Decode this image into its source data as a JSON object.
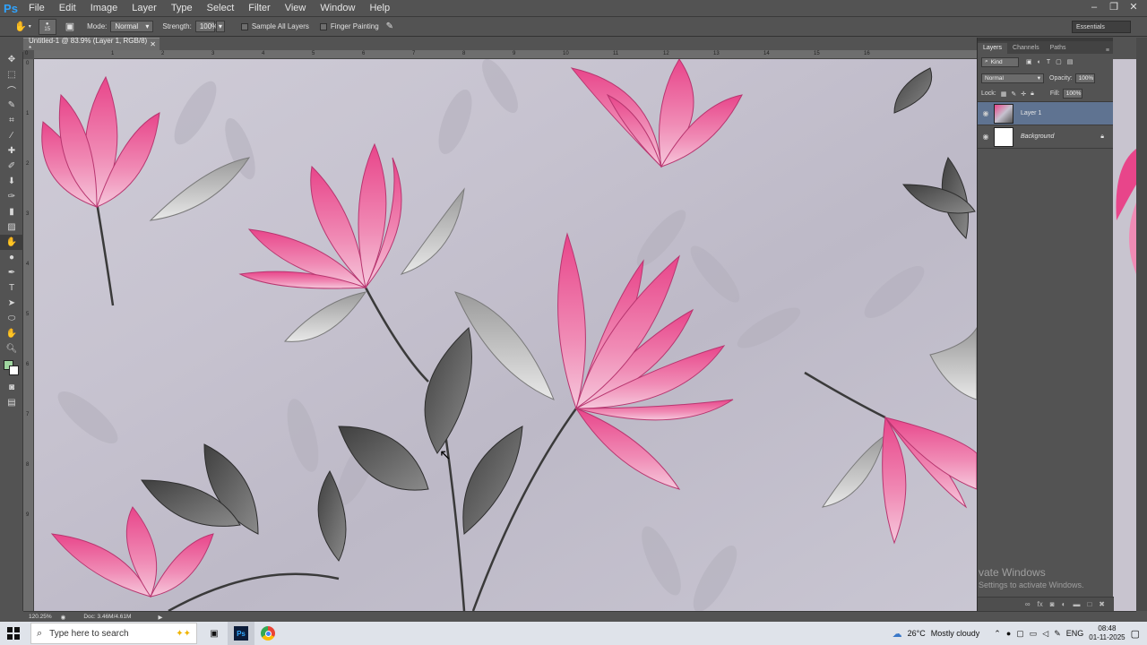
{
  "app": {
    "logo": "Ps"
  },
  "menu": [
    "File",
    "Edit",
    "Image",
    "Layer",
    "Type",
    "Select",
    "Filter",
    "View",
    "Window",
    "Help"
  ],
  "window_controls": [
    "minimize-icon",
    "restore-icon",
    "close-icon"
  ],
  "options_bar": {
    "brush_size": "15",
    "mode_label": "Mode:",
    "mode_value": "Normal",
    "strength_label": "Strength:",
    "strength_value": "100%",
    "sample_all_layers": "Sample All Layers",
    "finger_painting": "Finger Painting",
    "workspace": "Essentials"
  },
  "document_tab": {
    "title": "Untitled-1 @ 83.9% (Layer 1, RGB/8) *"
  },
  "ruler_top_ticks": [
    "0",
    "1",
    "2",
    "3",
    "4",
    "5",
    "6",
    "7",
    "8",
    "9",
    "10",
    "11",
    "12",
    "13",
    "14",
    "15",
    "16"
  ],
  "ruler_left_ticks": [
    "0",
    "1",
    "2",
    "3",
    "4",
    "5",
    "6",
    "7",
    "8",
    "9"
  ],
  "layers_panel": {
    "tabs": [
      "Layers",
      "Channels",
      "Paths"
    ],
    "filter_kind": "Kind",
    "blend_mode": "Normal",
    "opacity_label": "Opacity:",
    "opacity_value": "100%",
    "lock_label": "Lock:",
    "fill_label": "Fill:",
    "fill_value": "100%",
    "layers": [
      {
        "name": "Layer 1",
        "selected": true
      },
      {
        "name": "Background",
        "selected": false,
        "locked": true
      }
    ]
  },
  "watermark": {
    "line1": "vate Windows",
    "line2": "Settings to activate Windows."
  },
  "status_bar": {
    "zoom": "120.25%",
    "doc": "Doc: 3.46M/4.61M"
  },
  "taskbar": {
    "search_placeholder": "Type here to search",
    "weather_temp": "26°C",
    "weather_desc": "Mostly cloudy",
    "language": "ENG",
    "time": "08:48",
    "date": "01-11-2025"
  },
  "colors": {
    "foreground": "#9fd59f",
    "background": "#ffffff",
    "selected_layer": "#5f7391"
  }
}
